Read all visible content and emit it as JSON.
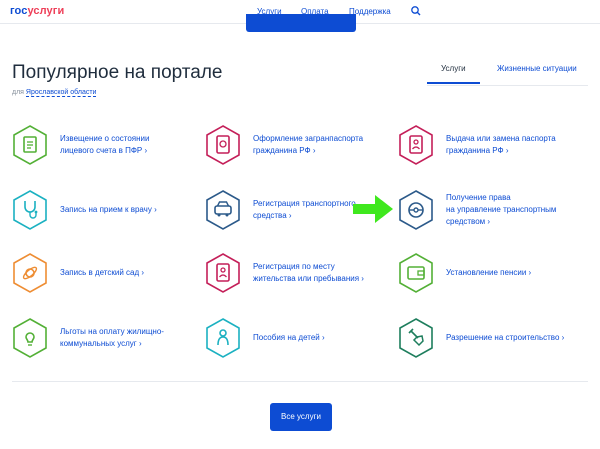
{
  "header": {
    "logo_part1": "гос",
    "logo_part2": "услуги",
    "nav": [
      "Услуги",
      "Оплата",
      "Поддержка"
    ],
    "search_icon": "search-icon"
  },
  "page": {
    "title": "Популярное на портале",
    "region_prefix": "для",
    "region_link": "Ярославской области"
  },
  "tabs": [
    {
      "label": "Услуги",
      "active": true
    },
    {
      "label": "Жизненные ситуации",
      "active": false
    }
  ],
  "colors": {
    "accent": "#0d4cd3",
    "green": "#53b036",
    "teal": "#1bb1c1",
    "orange": "#ee8d33",
    "crimson": "#c41f59",
    "navy": "#2c5a8a",
    "darkgreen": "#1e7e5d"
  },
  "services": [
    {
      "label": "Извещение о состоянии\nлицевого счета в ПФР",
      "icon": "document-icon",
      "color": "#53b036"
    },
    {
      "label": "Оформление загранпаспорта\nгражданина РФ",
      "icon": "passport-icon",
      "color": "#c41f59"
    },
    {
      "label": "Выдача или замена паспорта\nгражданина РФ",
      "icon": "id-card-icon",
      "color": "#c41f59"
    },
    {
      "label": "Запись на прием к врачу",
      "icon": "stethoscope-icon",
      "color": "#1bb1c1"
    },
    {
      "label": "Регистрация транспортного\nсредства",
      "icon": "car-icon",
      "color": "#2c5a8a"
    },
    {
      "label": "Получение права\nна управление транспортным\nсредством",
      "icon": "steering-wheel-icon",
      "color": "#2c5a8a"
    },
    {
      "label": "Запись в детский сад",
      "icon": "pacifier-icon",
      "color": "#ee8d33"
    },
    {
      "label": "Регистрация по месту\nжительства или пребывания",
      "icon": "registration-icon",
      "color": "#c41f59"
    },
    {
      "label": "Установление пенсии",
      "icon": "wallet-icon",
      "color": "#53b036"
    },
    {
      "label": "Льготы на оплату жилищно-\nкоммунальных услуг",
      "icon": "lightbulb-icon",
      "color": "#53b036"
    },
    {
      "label": "Пособия на детей",
      "icon": "child-icon",
      "color": "#1bb1c1"
    },
    {
      "label": "Разрешение на строительство",
      "icon": "shovel-icon",
      "color": "#1e7e5d"
    }
  ],
  "arrow_glyph": "›",
  "all_services_button": "Все услуги"
}
